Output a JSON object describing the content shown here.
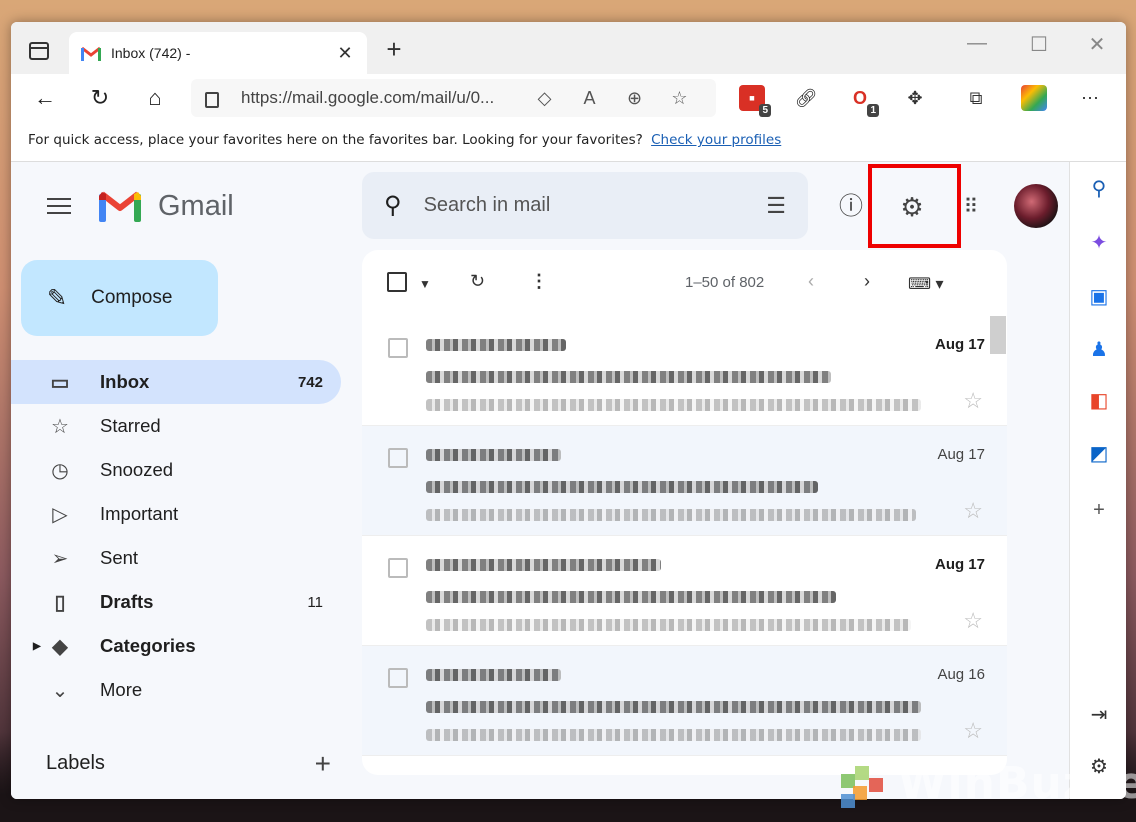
{
  "browser": {
    "tab_title": "Inbox (742) - ",
    "tab_close": "✕",
    "new_tab": "+",
    "url": "https://mail.google.com/mail/u/0...",
    "ext_badge_1": "5",
    "ext_badge_2": "1",
    "favbar_text": "For quick access, place your favorites here on the favorites bar. Looking for your favorites?",
    "favbar_link": "Check your profiles"
  },
  "gmail": {
    "logo_word": "Gmail",
    "compose_label": "Compose",
    "search_placeholder": "Search in mail",
    "nav": [
      {
        "label": "Inbox",
        "count": "742"
      },
      {
        "label": "Starred",
        "count": ""
      },
      {
        "label": "Snoozed",
        "count": ""
      },
      {
        "label": "Important",
        "count": ""
      },
      {
        "label": "Sent",
        "count": ""
      },
      {
        "label": "Drafts",
        "count": "11"
      },
      {
        "label": "Categories",
        "count": ""
      },
      {
        "label": "More",
        "count": ""
      }
    ],
    "labels_heading": "Labels",
    "pager_text": "1–50 of 802",
    "emails": [
      {
        "date": "Aug 17",
        "unread": true
      },
      {
        "date": "Aug 17",
        "unread": false
      },
      {
        "date": "Aug 17",
        "unread": true
      },
      {
        "date": "Aug 16",
        "unread": false
      }
    ]
  },
  "watermark": "WinBuzzer",
  "colors": {
    "compose_bg": "#c2e7ff",
    "active_nav_bg": "#d3e3fd",
    "highlight_border": "#e00000",
    "link": "#1a5fb4"
  }
}
